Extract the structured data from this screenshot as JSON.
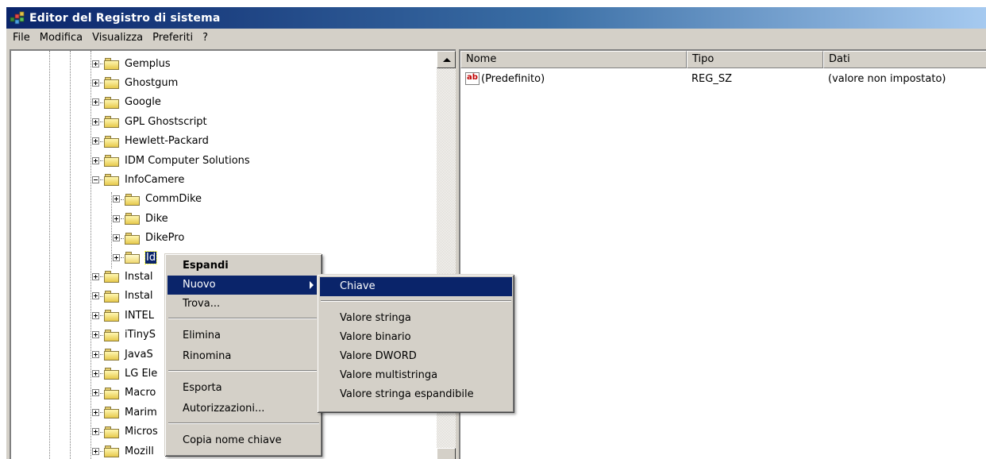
{
  "window": {
    "title": "Editor del Registro di sistema",
    "icon": "regedit-icon"
  },
  "menubar": [
    "File",
    "Modifica",
    "Visualizza",
    "Preferiti",
    "?"
  ],
  "tree": {
    "items": [
      {
        "label": "Gemplus",
        "expander": "plus"
      },
      {
        "label": "Ghostgum",
        "expander": "plus"
      },
      {
        "label": "Google",
        "expander": "plus"
      },
      {
        "label": "GPL Ghostscript",
        "expander": "plus"
      },
      {
        "label": "Hewlett-Packard",
        "expander": "plus"
      },
      {
        "label": "IDM Computer Solutions",
        "expander": "plus"
      },
      {
        "label": "InfoCamere",
        "expander": "minus"
      },
      {
        "label": "CommDike",
        "expander": "plus"
      },
      {
        "label": "Dike",
        "expander": "plus"
      },
      {
        "label": "DikePro",
        "expander": "plus"
      },
      {
        "label": "Id",
        "expander": "plus",
        "selected": true
      },
      {
        "label": "Instal",
        "expander": "plus"
      },
      {
        "label": "Instal",
        "expander": "plus"
      },
      {
        "label": "INTEL",
        "expander": "plus"
      },
      {
        "label": "iTinyS",
        "expander": "plus"
      },
      {
        "label": "JavaS",
        "expander": "plus"
      },
      {
        "label": "LG Ele",
        "expander": "plus"
      },
      {
        "label": "Macro",
        "expander": "plus"
      },
      {
        "label": "Marim",
        "expander": "plus"
      },
      {
        "label": "Micros",
        "expander": "plus"
      },
      {
        "label": "Mozill",
        "expander": "plus"
      }
    ]
  },
  "list": {
    "columns": [
      "Nome",
      "Tipo",
      "Dati"
    ],
    "rows": [
      {
        "name": "(Predefinito)",
        "type": "REG_SZ",
        "data": "(valore non impostato)",
        "icon": "ab"
      }
    ]
  },
  "context_menu": {
    "items": [
      "Espandi",
      "Nuovo",
      "Trova...",
      "Elimina",
      "Rinomina",
      "Esporta",
      "Autorizzazioni...",
      "Copia nome chiave"
    ]
  },
  "submenu": {
    "items": [
      "Chiave",
      "Valore stringa",
      "Valore binario",
      "Valore DWORD",
      "Valore multistringa",
      "Valore stringa espandibile"
    ]
  },
  "colors": {
    "highlight": "#0a246a",
    "face": "#d4d0c8",
    "title_start": "#0a246a",
    "title_end": "#a6caf0"
  }
}
